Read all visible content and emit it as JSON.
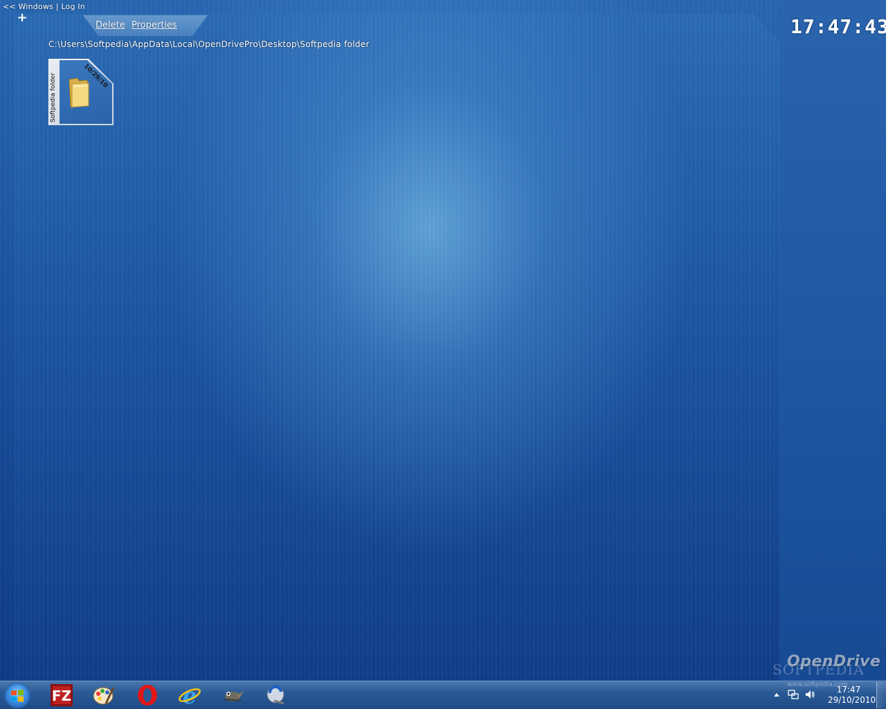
{
  "top_nav": {
    "prefix": "<<",
    "windows_label": "Windows",
    "separator": "|",
    "login_label": "Log In"
  },
  "toolbar": {
    "delete_label": "Delete",
    "properties_label": "Properties"
  },
  "path": "C:\\Users\\Softpedia\\AppData\\Local\\OpenDrivePro\\Desktop\\Softpedia folder",
  "clock": "17:47:43",
  "folder_item": {
    "name": "Softpedia folder",
    "date": "10/29/10"
  },
  "watermarks": {
    "opendrive": "OpenDrive",
    "softpedia": "SOFTPEDIA",
    "site": "www.softpedia.com"
  },
  "taskbar": {
    "icons": [
      "start-orb-icon",
      "filezilla-icon",
      "paint-icon",
      "opera-icon",
      "internet-explorer-icon",
      "gimp-icon",
      "app-icon"
    ],
    "tray_time": "17:47",
    "tray_date": "29/10/2010"
  },
  "colors": {
    "panel_blue": "#1f5aa6",
    "taskbar_blue": "#2a5a96",
    "text": "#ffffff"
  }
}
